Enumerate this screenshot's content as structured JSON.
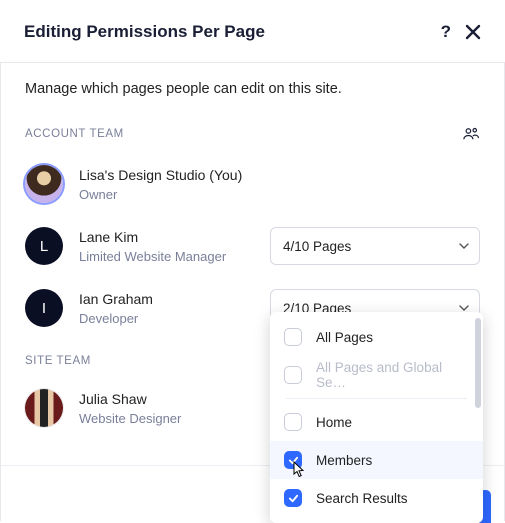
{
  "header": {
    "title": "Editing Permissions Per Page"
  },
  "intro": "Manage which pages people can edit on this site.",
  "sections": {
    "account_label": "ACCOUNT TEAM",
    "site_label": "SITE TEAM"
  },
  "people": {
    "lisa": {
      "name": "Lisa's Design Studio (You)",
      "role": "Owner",
      "initial": ""
    },
    "lane": {
      "name": "Lane Kim",
      "role": "Limited Website Manager",
      "initial": "L",
      "pages": "4/10 Pages"
    },
    "ian": {
      "name": "Ian Graham",
      "role": "Developer",
      "initial": "I",
      "pages": "2/10 Pages"
    },
    "julia": {
      "name": "Julia Shaw",
      "role": "Website Designer"
    }
  },
  "dropdown": {
    "all_pages": "All Pages",
    "all_global": "All Pages and Global Se…",
    "home": "Home",
    "members": "Members",
    "search": "Search Results"
  }
}
